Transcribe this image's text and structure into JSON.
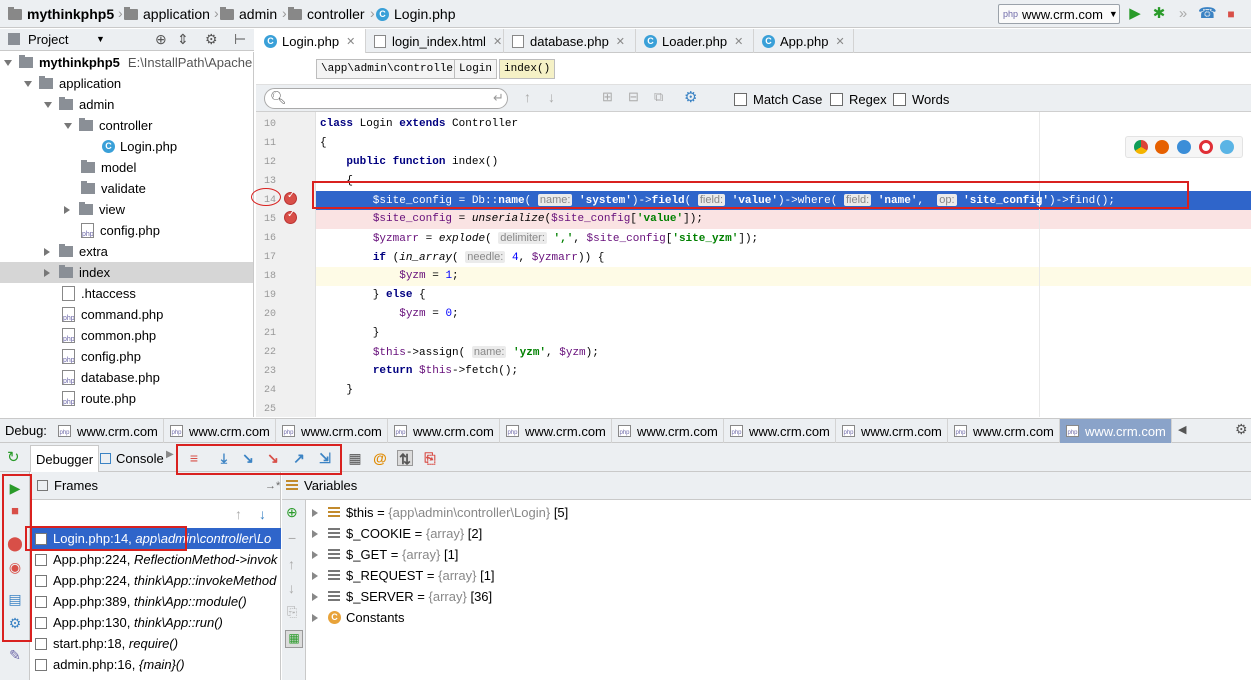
{
  "navbar": {
    "crumbs": [
      "mythinkphp5",
      "application",
      "admin",
      "controller",
      "Login.php"
    ],
    "run_config": "www.crm.com"
  },
  "project_panel": {
    "title": "Project",
    "root_name": "mythinkphp5",
    "root_path": "E:\\InstallPath\\Apache",
    "items": [
      {
        "label": "application"
      },
      {
        "label": "admin"
      },
      {
        "label": "controller"
      },
      {
        "label": "Login.php"
      },
      {
        "label": "model"
      },
      {
        "label": "validate"
      },
      {
        "label": "view"
      },
      {
        "label": "config.php"
      },
      {
        "label": "extra"
      },
      {
        "label": "index"
      },
      {
        "label": ".htaccess"
      },
      {
        "label": "command.php"
      },
      {
        "label": "common.php"
      },
      {
        "label": "config.php"
      },
      {
        "label": "database.php"
      },
      {
        "label": "route.php"
      }
    ]
  },
  "editor_tabs": [
    {
      "label": "Login.php"
    },
    {
      "label": "login_index.html"
    },
    {
      "label": "database.php"
    },
    {
      "label": "Loader.php"
    },
    {
      "label": "App.php"
    }
  ],
  "breadcrumb2": [
    "\\app\\admin\\controller",
    "Login",
    "index()"
  ],
  "find_bar": {
    "match_case": "Match Case",
    "regex": "Regex",
    "words": "Words"
  },
  "code": {
    "line_numbers": [
      "10",
      "11",
      "12",
      "13",
      "14",
      "15",
      "16",
      "17",
      "18",
      "19",
      "20",
      "21",
      "22",
      "23",
      "24",
      "25"
    ],
    "current_line": "14"
  },
  "debug_bar": {
    "label": "Debug:",
    "tabs": [
      "www.crm.com",
      "www.crm.com",
      "www.crm.com",
      "www.crm.com",
      "www.crm.com",
      "www.crm.com",
      "www.crm.com",
      "www.crm.com",
      "www.crm.com",
      "www.crm.com"
    ]
  },
  "debugger_tabs": {
    "debugger": "Debugger",
    "console": "Console"
  },
  "frames": {
    "title": "Frames",
    "items": [
      {
        "file": "Login.php:14,",
        "method": "app\\admin\\controller\\Lo"
      },
      {
        "file": "App.php:224,",
        "method": "ReflectionMethod->invok"
      },
      {
        "file": "App.php:224,",
        "method": "think\\App::invokeMethod"
      },
      {
        "file": "App.php:389,",
        "method": "think\\App::module()"
      },
      {
        "file": "App.php:130,",
        "method": "think\\App::run()"
      },
      {
        "file": "start.php:18,",
        "method": "require()"
      },
      {
        "file": "admin.php:16,",
        "method": "{main}()"
      }
    ]
  },
  "variables": {
    "title": "Variables",
    "items": [
      {
        "name": "$this",
        "eq": " = ",
        "type": "{app\\admin\\controller\\Login}",
        "count": "[5]"
      },
      {
        "name": "$_COOKIE",
        "eq": " = ",
        "type": "{array}",
        "count": "[2]"
      },
      {
        "name": "$_GET",
        "eq": " = ",
        "type": "{array}",
        "count": "[1]"
      },
      {
        "name": "$_REQUEST",
        "eq": " = ",
        "type": "{array}",
        "count": "[1]"
      },
      {
        "name": "$_SERVER",
        "eq": " = ",
        "type": "{array}",
        "count": "[36]"
      },
      {
        "name": "Constants",
        "eq": "",
        "type": "",
        "count": ""
      }
    ]
  },
  "colors": {
    "selection": "#2f65ca",
    "annotation": "#d9211f",
    "breakpoint": "#d84f48"
  }
}
